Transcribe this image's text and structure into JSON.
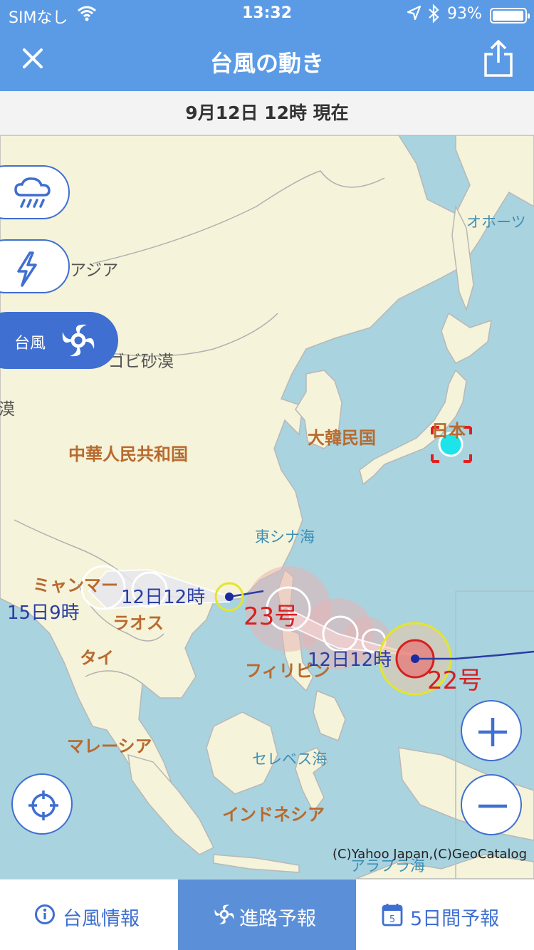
{
  "status_bar": {
    "carrier": "SIMなし",
    "time": "13:32",
    "battery": "93%"
  },
  "nav": {
    "title": "台風の動き"
  },
  "date_bar": {
    "text": "9月12日 12時 現在"
  },
  "map": {
    "labels": {
      "okhotsk": "オホーツ",
      "asia": "アジア",
      "gobi": "ゴビ砂漠",
      "desert_edge": "漠",
      "korea": "大韓民国",
      "japan": "日本",
      "china": "中華人民共和国",
      "east_china_sea": "東シナ海",
      "myanmar": "ミャンマー",
      "laos": "ラオス",
      "thailand": "タイ",
      "philippines": "フィリピン",
      "malaysia": "マレーシア",
      "celebes_sea": "セレベス海",
      "indonesia": "インドネシア",
      "arafura_sea": "アラフラ海"
    },
    "typhoons": [
      {
        "name": "23号",
        "time_current": "12日12時",
        "time_forecast": "15日9時"
      },
      {
        "name": "22号",
        "time_current": "12日12時"
      }
    ],
    "copyright": "(C)Yahoo Japan,(C)GeoCatalog",
    "side_buttons": {
      "rain_icon": "rain-cloud-icon",
      "lightning_icon": "lightning-icon",
      "typhoon_label": "台風"
    }
  },
  "tabs": [
    {
      "label": "台風情報",
      "icon": "info-icon",
      "active": false
    },
    {
      "label": "進路予報",
      "icon": "typhoon-icon",
      "active": true
    },
    {
      "label": "5日間予報",
      "icon": "calendar-icon",
      "active": false
    }
  ],
  "colors": {
    "header": "#5b9be6",
    "accent": "#3f6fd1",
    "land": "#f5f3d9",
    "sea": "#a9d3df",
    "storm_red": "#d62020"
  }
}
